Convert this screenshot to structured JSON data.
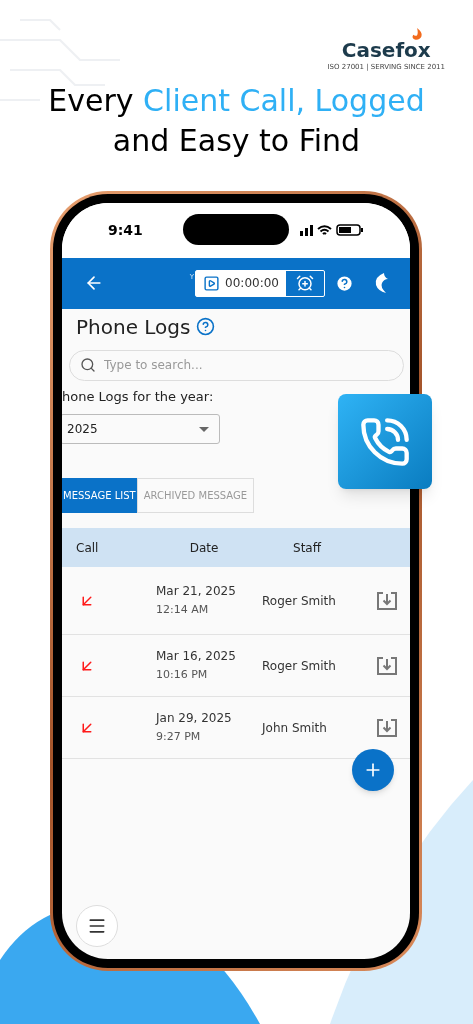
{
  "logo": {
    "name": "Casefox",
    "tagline": "ISO 27001 | SERVING SINCE 2011"
  },
  "headline": [
    {
      "text": "Every ",
      "highlight": false
    },
    {
      "text": "Client Call, Logged",
      "highlight": true
    },
    {
      "text": " and Easy to Find",
      "highlight": false
    }
  ],
  "status_bar": {
    "time": "9:41"
  },
  "header": {
    "title_fragment": "Y",
    "timer": "00:00:00"
  },
  "page": {
    "title": "Phone Logs",
    "search": {
      "placeholder": "Type to search..."
    },
    "year_label": "hone Logs for the year:",
    "year_select": "2025"
  },
  "tabs": [
    {
      "label": "MESSAGE LIST",
      "selected": true
    },
    {
      "label": "ARCHIVED MESSAGE",
      "selected": false
    }
  ],
  "table": {
    "columns": [
      "Call",
      "Date",
      "Staff"
    ],
    "rows": [
      {
        "kind": "incoming",
        "date": "Mar 21, 2025",
        "time": "12:14 AM",
        "staff": "Roger Smith"
      },
      {
        "kind": "incoming",
        "date": "Mar 16, 2025",
        "time": "10:16 PM",
        "staff": "Roger Smith"
      },
      {
        "kind": "incoming",
        "date": "Jan 29, 2025",
        "time": "9:27 PM",
        "staff": "John Smith"
      }
    ]
  }
}
